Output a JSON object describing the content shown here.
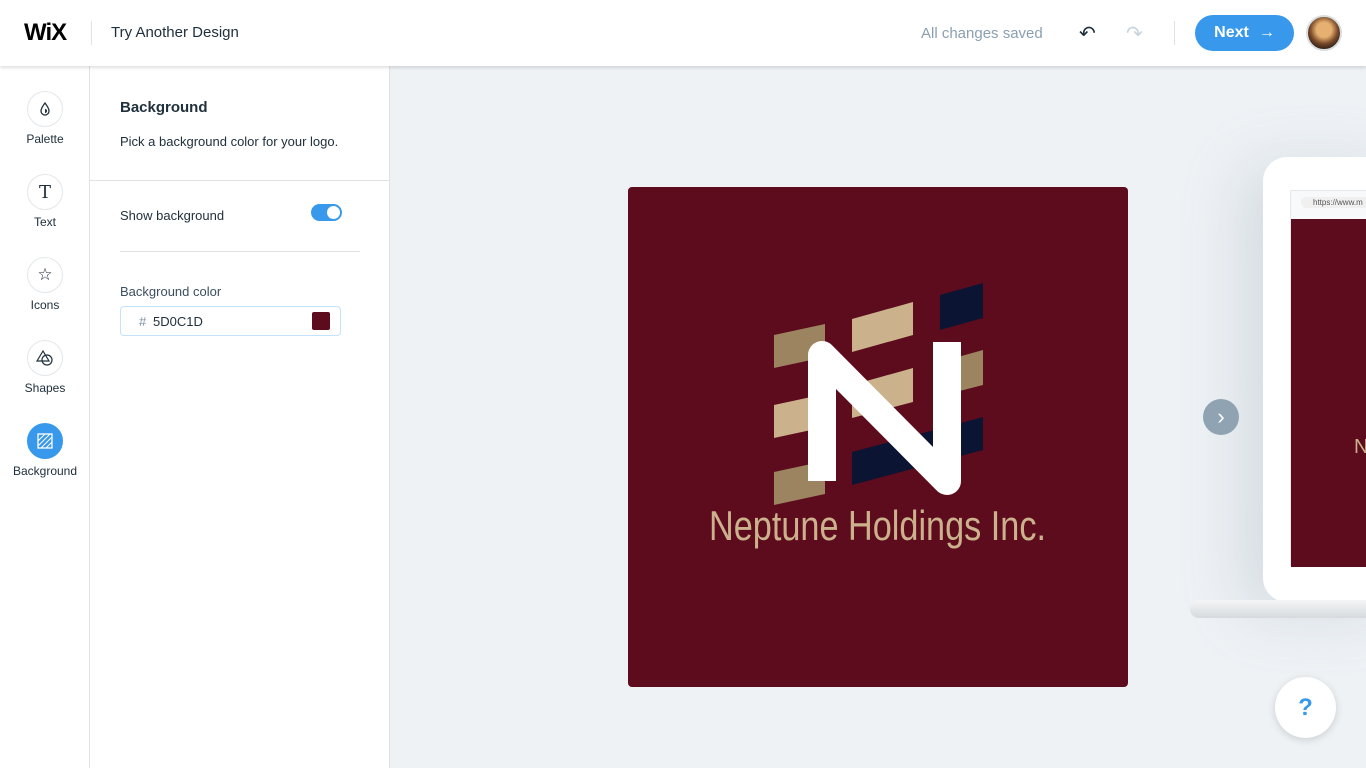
{
  "header": {
    "brand": "WiX",
    "title": "Try Another Design",
    "status": "All changes saved",
    "next_label": "Next",
    "next_icon": "arrow-right-icon"
  },
  "sidebar": {
    "items": [
      {
        "label": "Palette",
        "icon": "droplet-icon"
      },
      {
        "label": "Text",
        "icon": "text-icon"
      },
      {
        "label": "Icons",
        "icon": "star-icon"
      },
      {
        "label": "Shapes",
        "icon": "shapes-icon"
      },
      {
        "label": "Background",
        "icon": "background-icon",
        "active": true
      }
    ]
  },
  "panel": {
    "title": "Background",
    "description": "Pick a background color for your logo.",
    "show_background_label": "Show background",
    "show_background": true,
    "background_color_label": "Background color",
    "hash": "#",
    "background_color_value": "5D0C1D"
  },
  "canvas": {
    "company_name": "Neptune Holdings Inc.",
    "monogram": "N",
    "background_color": "#5d0c1d",
    "accent_light": "#cbb28c",
    "accent_dark": "#9c8460",
    "accent_navy": "#0c1433",
    "preview_url": "https://www.m",
    "preview_initial": "N"
  },
  "help": {
    "label": "?"
  },
  "colors": {
    "accent": "#3899ec"
  }
}
